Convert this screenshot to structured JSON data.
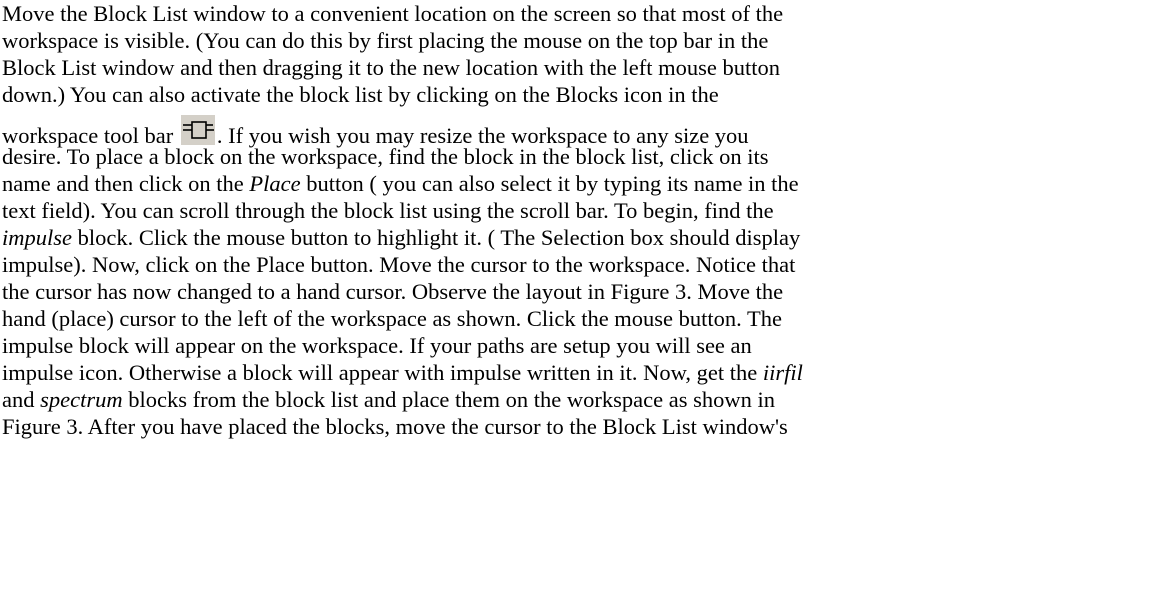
{
  "paragraph": {
    "l1": "Move the Block List window to a convenient location on the screen so that most of the",
    "l2": "workspace is visible. (You can do this by first placing the mouse on the top bar  in the",
    "l3": "Block List window and then dragging it to the new location with the left mouse button",
    "l4": "down.)  You can also activate the block list by clicking on the Blocks icon in the",
    "l5a": "workspace tool bar ",
    "l5b": ". If you wish you may resize the workspace to any size you",
    "l6": "desire. To place a block on the workspace, find the block in the block list, click on its",
    "l7a": "name and then click on the ",
    "l7b": "Place",
    "l7c": " button ( you can also select it by typing its name in the",
    "l8": "text field). You can scroll through the block list using the scroll bar. To begin, find the",
    "l9a": "impulse",
    "l9b": " block. Click the mouse button to highlight it. ( The Selection box should display",
    "l10": "impulse). Now, click on the Place button. Move the cursor to the workspace. Notice that",
    "l11": "the cursor has now changed to a hand cursor. Observe the layout in Figure 3. Move the",
    "l12": "hand (place) cursor to the left of the workspace as shown. Click the mouse button. The",
    "l13": "impulse block will appear on the workspace. If your paths are setup you will see an",
    "l14a": "impulse icon. Otherwise a block will appear with impulse written in it.  Now, get the ",
    "l14b": "iirfil",
    "l15a": "and ",
    "l15b": "spectrum",
    "l15c": " blocks from the block list and place them on the workspace as shown in",
    "l16": "Figure 3.  After you have placed the blocks, move the cursor to the Block List window's"
  },
  "icons": {
    "blocks_toolbar_icon": "blocks-icon"
  }
}
